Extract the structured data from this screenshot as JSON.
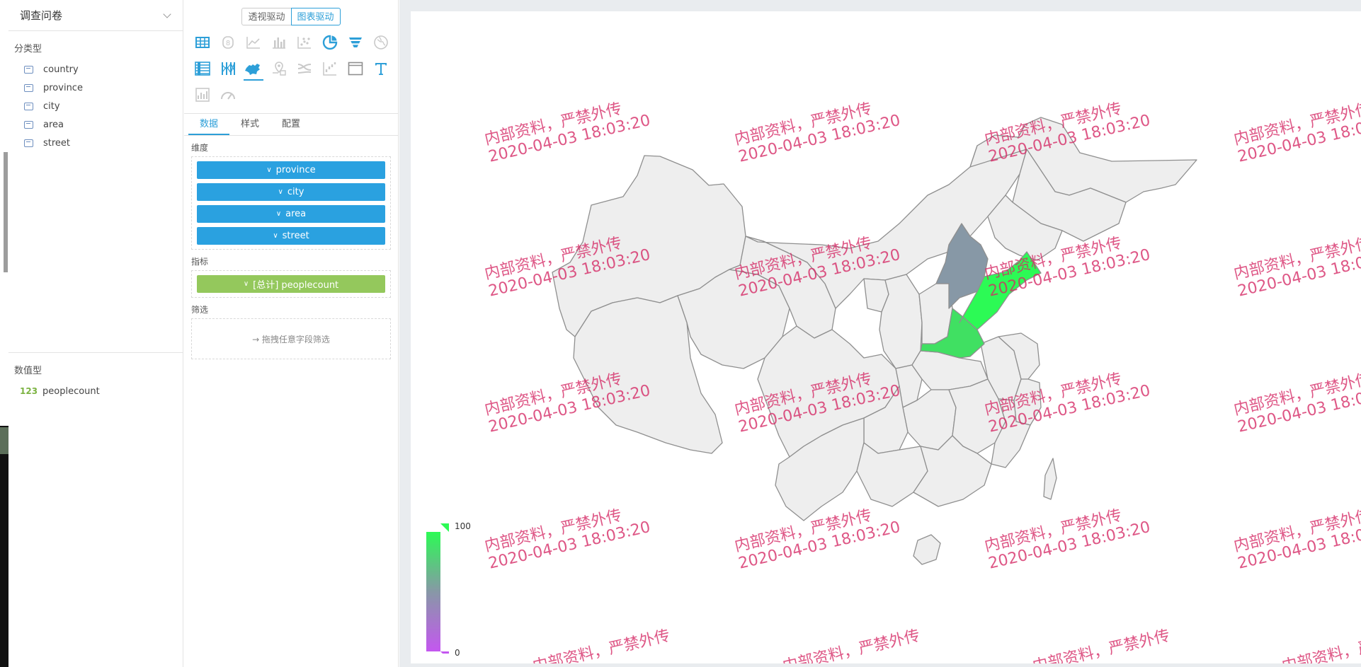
{
  "dataset": {
    "name": "调查问卷"
  },
  "field_groups": {
    "dimension_title": "分类型",
    "dimensions": [
      {
        "name": "country"
      },
      {
        "name": "province"
      },
      {
        "name": "city"
      },
      {
        "name": "area"
      },
      {
        "name": "street"
      }
    ],
    "measure_title": "数值型",
    "measures": [
      {
        "icon_text": "123",
        "name": "peoplecount"
      }
    ]
  },
  "mode_toggle": {
    "pivot_label": "透视驱动",
    "chart_label": "图表驱动",
    "active": "chart"
  },
  "chart_types": [
    {
      "icon": "table-icon",
      "active": false,
      "enabled": true
    },
    {
      "icon": "number-icon",
      "active": false,
      "enabled": false
    },
    {
      "icon": "line-chart-icon",
      "active": false,
      "enabled": false
    },
    {
      "icon": "bar-chart-icon",
      "active": false,
      "enabled": false
    },
    {
      "icon": "scatter-icon",
      "active": false,
      "enabled": false
    },
    {
      "icon": "pie-chart-icon",
      "active": false,
      "enabled": true
    },
    {
      "icon": "funnel-icon",
      "active": false,
      "enabled": true
    },
    {
      "icon": "globe-icon",
      "active": false,
      "enabled": false
    },
    {
      "icon": "stacked-table-icon",
      "active": false,
      "enabled": true
    },
    {
      "icon": "parallel-icon",
      "active": false,
      "enabled": true
    },
    {
      "icon": "china-map-icon",
      "active": true,
      "enabled": true
    },
    {
      "icon": "map-pin-icon",
      "active": false,
      "enabled": false
    },
    {
      "icon": "sankey-icon",
      "active": false,
      "enabled": false
    },
    {
      "icon": "waterfall-icon",
      "active": false,
      "enabled": false
    },
    {
      "icon": "iframe-icon",
      "active": false,
      "enabled": true
    },
    {
      "icon": "text-icon",
      "active": false,
      "enabled": true
    },
    {
      "icon": "image-icon",
      "active": false,
      "enabled": false
    },
    {
      "icon": "gauge-icon",
      "active": false,
      "enabled": false
    }
  ],
  "tabs": [
    {
      "label": "数据",
      "active": true
    },
    {
      "label": "样式",
      "active": false
    },
    {
      "label": "配置",
      "active": false
    }
  ],
  "dimension_section": {
    "label": "维度",
    "pills": [
      "province",
      "city",
      "area",
      "street"
    ]
  },
  "metric_section": {
    "label": "指标",
    "pills": [
      "[总计] peoplecount"
    ]
  },
  "filter_section": {
    "label": "筛选",
    "placeholder": "→ 拖拽任意字段筛选"
  },
  "colors": {
    "accent": "#2d9fd8",
    "dim_pill": "#2aa1e0",
    "metric_pill": "#94c85c",
    "map_empty": "#eeeeee",
    "map_border": "#8f8f8f",
    "scale_high": "#2cfa55",
    "scale_mid": "#8798a6",
    "scale_low": "#c457f0",
    "watermark": "#d52864"
  },
  "watermark": {
    "line1": "内部资料，严禁外传",
    "line2": "2020-04-03 18:03:20"
  },
  "chart_data": {
    "type": "map",
    "map": "china",
    "visual_map": {
      "min": 0,
      "max": 100,
      "min_label": "0",
      "max_label": "100"
    },
    "highlighted_regions": [
      {
        "region": "Shandong",
        "level": "high"
      },
      {
        "region": "Henan",
        "level": "high"
      },
      {
        "region": "Hebei",
        "level": "mid"
      }
    ]
  }
}
